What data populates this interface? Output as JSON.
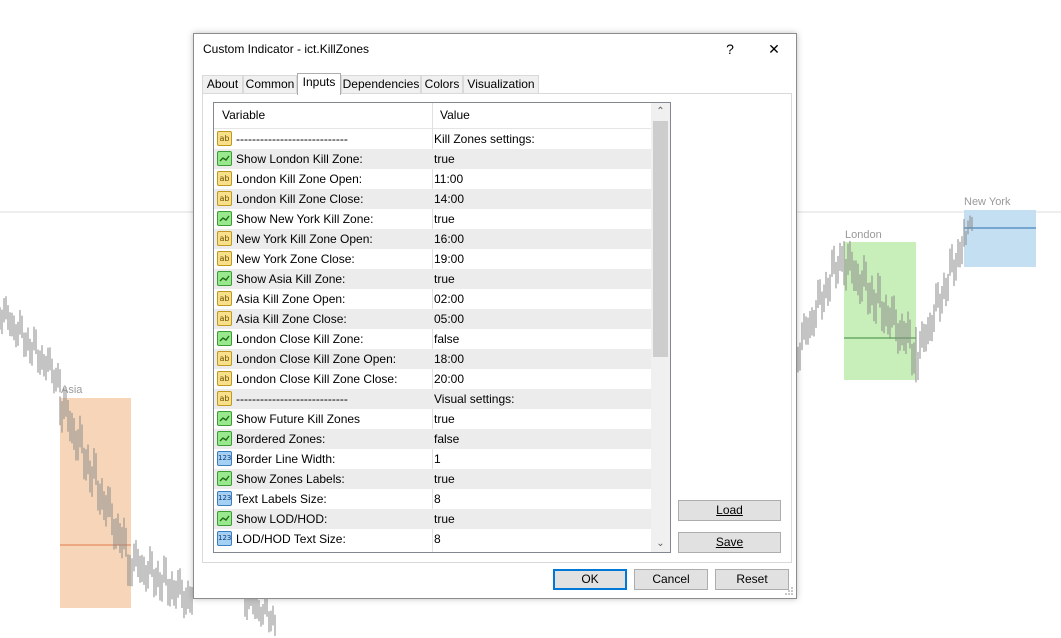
{
  "chart": {
    "zones": [
      {
        "label": "Asia",
        "color": "#f6d5b8"
      },
      {
        "label": "London",
        "color": "#c8efb9"
      },
      {
        "label": "New York",
        "color": "#c4dff2"
      }
    ]
  },
  "dialog": {
    "title": "Custom Indicator - ict.KillZones",
    "help_label": "?",
    "close_label": "✕",
    "tabs": [
      "About",
      "Common",
      "Inputs",
      "Dependencies",
      "Colors",
      "Visualization"
    ],
    "active_tab": "Inputs",
    "grid": {
      "columns": {
        "variable": "Variable",
        "value": "Value"
      },
      "rows": [
        {
          "type": "string",
          "variable": "----------------------------",
          "value": "Kill Zones settings:"
        },
        {
          "type": "bool",
          "variable": "Show London Kill Zone:",
          "value": "true"
        },
        {
          "type": "string",
          "variable": "London Kill Zone Open:",
          "value": "11:00"
        },
        {
          "type": "string",
          "variable": "London Kill Zone Close:",
          "value": "14:00"
        },
        {
          "type": "bool",
          "variable": "Show New York Kill Zone:",
          "value": "true"
        },
        {
          "type": "string",
          "variable": "New York Kill Zone Open:",
          "value": "16:00"
        },
        {
          "type": "string",
          "variable": "New York Zone Close:",
          "value": "19:00"
        },
        {
          "type": "bool",
          "variable": "Show Asia Kill Zone:",
          "value": "true"
        },
        {
          "type": "string",
          "variable": "Asia Kill Zone Open:",
          "value": "02:00"
        },
        {
          "type": "string",
          "variable": "Asia Kill Zone Close:",
          "value": "05:00"
        },
        {
          "type": "bool",
          "variable": "London Close Kill Zone:",
          "value": "false"
        },
        {
          "type": "string",
          "variable": "London Close Kill Zone Open:",
          "value": "18:00"
        },
        {
          "type": "string",
          "variable": "London Close Kill Zone Close:",
          "value": "20:00"
        },
        {
          "type": "string",
          "variable": "----------------------------",
          "value": "Visual settings:"
        },
        {
          "type": "bool",
          "variable": "Show Future Kill Zones",
          "value": "true"
        },
        {
          "type": "bool",
          "variable": "Bordered Zones:",
          "value": "false"
        },
        {
          "type": "number",
          "variable": "Border Line Width:",
          "value": "1"
        },
        {
          "type": "bool",
          "variable": "Show Zones Labels:",
          "value": "true"
        },
        {
          "type": "number",
          "variable": "Text Labels Size:",
          "value": "8"
        },
        {
          "type": "bool",
          "variable": "Show LOD/HOD:",
          "value": "true"
        },
        {
          "type": "number",
          "variable": "LOD/HOD Text Size:",
          "value": "8"
        }
      ]
    },
    "load_label": "Load",
    "save_label": "Save",
    "ok_label": "OK",
    "cancel_label": "Cancel",
    "reset_label": "Reset"
  },
  "icons": {
    "string": "ab",
    "bool": "checkbox-icon",
    "number": "123"
  }
}
